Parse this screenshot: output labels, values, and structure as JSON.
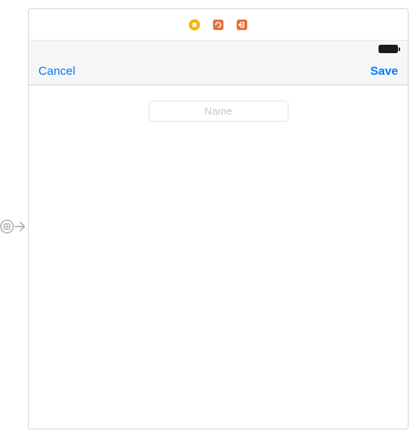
{
  "simulator": {
    "icons": [
      "home-icon",
      "rotate-icon",
      "logout-icon"
    ]
  },
  "status": {
    "battery_level": 100
  },
  "nav": {
    "cancel_label": "Cancel",
    "save_label": "Save"
  },
  "form": {
    "name_placeholder": "Name",
    "name_value": ""
  },
  "colors": {
    "accent": "#007aff",
    "toolbar_yellow": "#f7b500",
    "toolbar_orange": "#e86f3d",
    "toolbar_orange2": "#ea6c2f"
  }
}
